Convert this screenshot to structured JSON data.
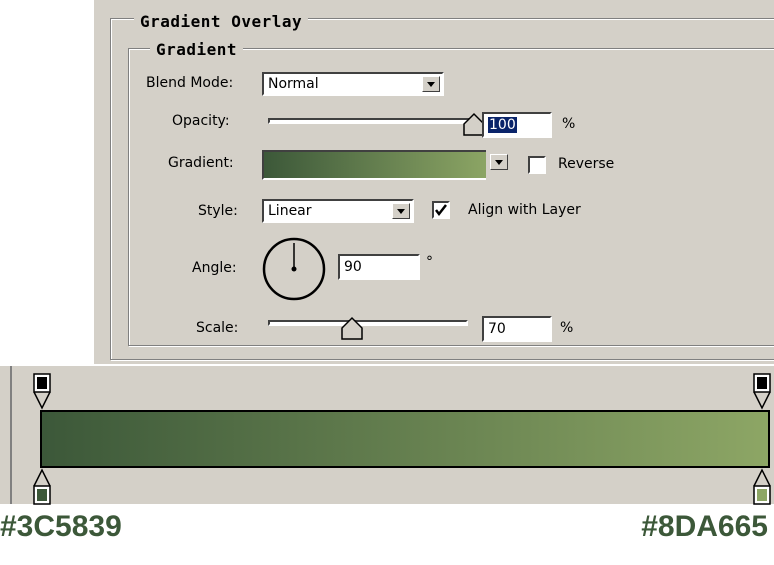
{
  "panel": {
    "outer_legend": "Gradient Overlay",
    "inner_legend": "Gradient"
  },
  "fields": {
    "blend_mode_label": "Blend Mode:",
    "blend_mode_value": "Normal",
    "opacity_label": "Opacity:",
    "opacity_value": "100",
    "opacity_unit": "%",
    "opacity_level": 1.0,
    "gradient_label": "Gradient:",
    "reverse_label": "Reverse",
    "reverse_checked": false,
    "style_label": "Style:",
    "style_value": "Linear",
    "align_label": "Align with Layer",
    "align_checked": true,
    "angle_label": "Angle:",
    "angle_value": "90",
    "angle_unit": "°",
    "scale_label": "Scale:",
    "scale_value": "70",
    "scale_unit": "%",
    "scale_level": 0.42
  },
  "colors": {
    "start": "#3C5839",
    "end": "#8DA665"
  },
  "hex_labels": {
    "start": "#3C5839",
    "end": "#8DA665"
  }
}
